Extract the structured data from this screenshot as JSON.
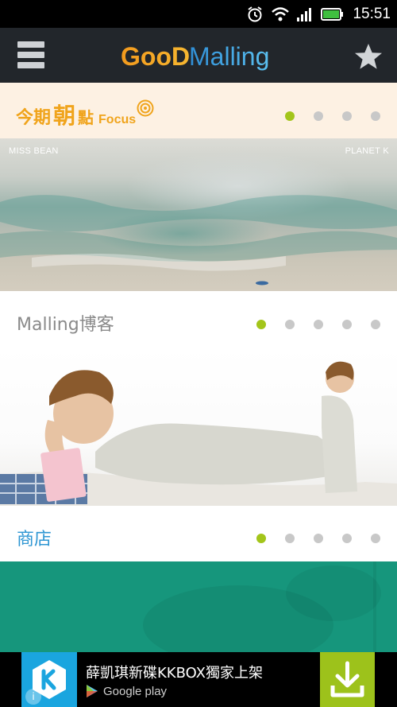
{
  "status_bar": {
    "time": "15:51",
    "icons": [
      "alarm-icon",
      "wifi-icon",
      "signal-icon",
      "battery-icon"
    ]
  },
  "header": {
    "logo_text": "GooD Malling",
    "menu_icon": "hamburger-menu-icon",
    "favorite_icon": "star-icon"
  },
  "focus": {
    "title_part1": "今期",
    "title_part2": "朝",
    "title_part3": "點",
    "title_latin": "Focus",
    "page_count": 4,
    "active_page": 1,
    "banner_left_label": "MISS BEAN",
    "banner_right_label": "PLANET K"
  },
  "blog": {
    "title": "Malling博客",
    "page_count": 5,
    "active_page": 1
  },
  "shop": {
    "title": "商店",
    "page_count": 5,
    "active_page": 1
  },
  "ad": {
    "text": "薛凱琪新碟KKBOX獨家上架",
    "store_label": "Google play",
    "colors": {
      "brand": "#1aa5df",
      "download": "#9dc21b"
    }
  },
  "colors": {
    "accent": "#a3c51a",
    "focus_title": "#f0a41c",
    "shop_title": "#2e96d3",
    "header_bg": "#22262b",
    "teal_block": "#16967c"
  }
}
